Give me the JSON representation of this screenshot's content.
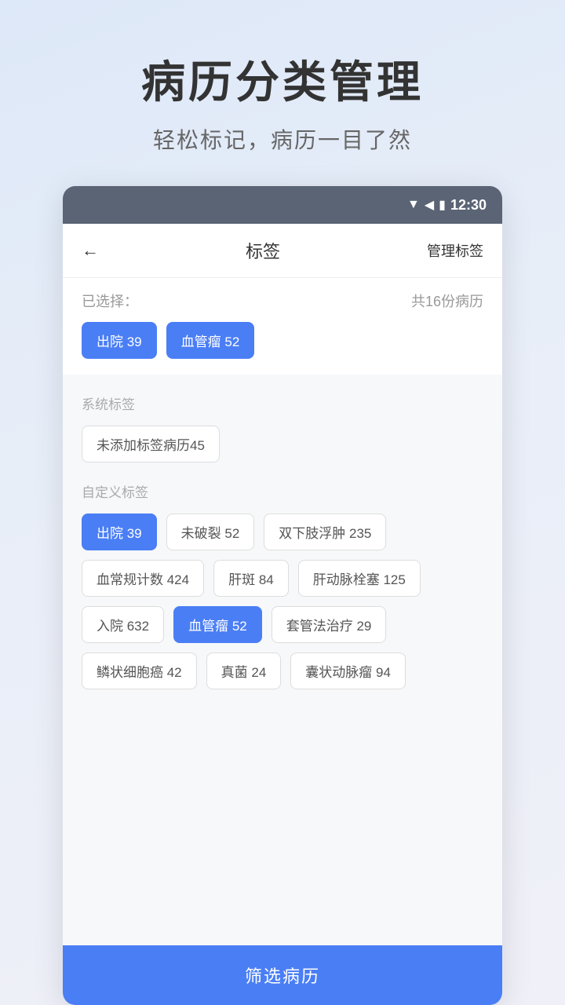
{
  "hero": {
    "title": "病历分类管理",
    "subtitle": "轻松标记，病历一目了然"
  },
  "statusBar": {
    "time": "12:30"
  },
  "nav": {
    "backLabel": "←",
    "title": "标签",
    "action": "管理标签"
  },
  "selectedSection": {
    "label": "已选择：",
    "count": "共16份病历",
    "activeTags": [
      {
        "id": "discharge",
        "text": "出院 39",
        "active": true
      },
      {
        "id": "angioma",
        "text": "血管瘤 52",
        "active": true
      }
    ]
  },
  "systemTags": {
    "sectionTitle": "系统标签",
    "tags": [
      {
        "id": "unlabeled",
        "text": "未添加标签病历45",
        "active": false
      }
    ]
  },
  "customTags": {
    "sectionTitle": "自定义标签",
    "rows": [
      [
        {
          "id": "discharge2",
          "text": "出院 39",
          "active": true
        },
        {
          "id": "unruptured",
          "text": "未破裂 52",
          "active": false
        },
        {
          "id": "bilateral",
          "text": "双下肢浮肿 235",
          "active": false
        }
      ],
      [
        {
          "id": "bloodcount",
          "text": "血常规计数 424",
          "active": false
        },
        {
          "id": "liverspots",
          "text": "肝斑 84",
          "active": false
        },
        {
          "id": "hepatic",
          "text": "肝动脉栓塞 125",
          "active": false
        }
      ],
      [
        {
          "id": "admission",
          "text": "入院 632",
          "active": false
        },
        {
          "id": "angioma2",
          "text": "血管瘤 52",
          "active": true
        },
        {
          "id": "catheter",
          "text": "套管法治疗 29",
          "active": false
        }
      ],
      [
        {
          "id": "squamous",
          "text": "鳞状细胞癌 42",
          "active": false
        },
        {
          "id": "fungal",
          "text": "真菌 24",
          "active": false
        },
        {
          "id": "cystic",
          "text": "囊状动脉瘤 94",
          "active": false
        }
      ]
    ]
  },
  "footer": {
    "buttonLabel": "筛选病历"
  }
}
